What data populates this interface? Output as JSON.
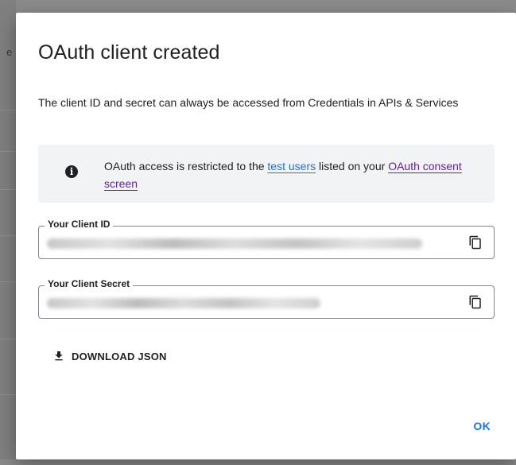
{
  "background": {
    "partial_letter": "e"
  },
  "dialog": {
    "title": "OAuth client created",
    "description": "The client ID and secret can always be accessed from Credentials in APIs & Services",
    "notice": {
      "icon": "info-icon",
      "text_before": "OAuth access is restricted to the ",
      "link_test_users": "test users",
      "text_middle": " listed on your ",
      "link_consent": "OAuth consent screen"
    },
    "client_id": {
      "label": "Your Client ID",
      "value": "",
      "copy_icon": "copy-icon"
    },
    "client_secret": {
      "label": "Your Client Secret",
      "value": "",
      "copy_icon": "copy-icon"
    },
    "download_label": "DOWNLOAD JSON",
    "download_icon": "download-icon",
    "ok_label": "OK"
  },
  "colors": {
    "accent": "#1a73e8",
    "visited_link": "#681da8",
    "notice_bg": "#f1f3f4",
    "text": "#202124"
  }
}
